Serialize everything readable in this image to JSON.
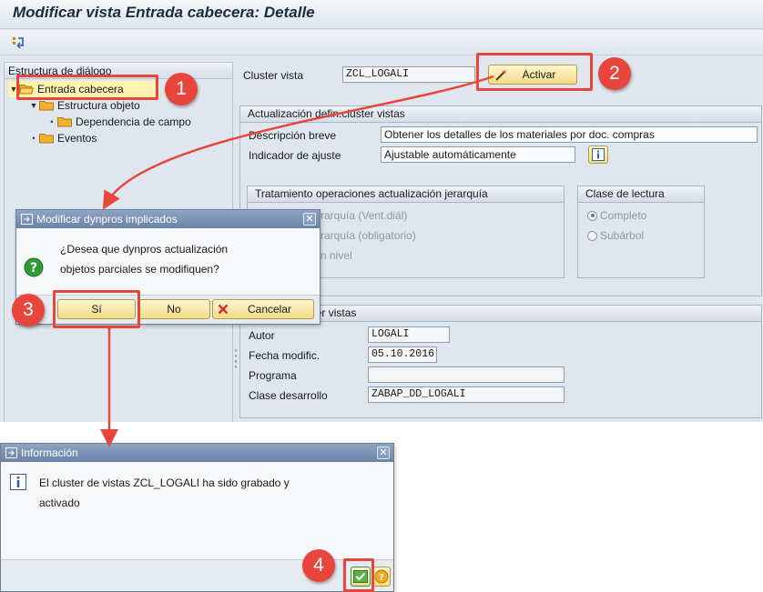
{
  "window": {
    "title": "Modificar vista Entrada cabecera: Detalle"
  },
  "tree": {
    "header": "Estructura de diálogo",
    "items": [
      {
        "label": "Entrada cabecera",
        "selected": true
      },
      {
        "label": "Estructura objeto",
        "selected": false
      },
      {
        "label": "Dependencia de campo",
        "selected": false
      },
      {
        "label": "Eventos",
        "selected": false
      }
    ]
  },
  "cluster": {
    "label": "Cluster vista",
    "value": "ZCL_LOGALI",
    "activate_label": "Activar"
  },
  "group_update": {
    "title": "Actualización defin.cluster vistas",
    "desc_label": "Descripción breve",
    "desc_value": "Obtener los detalles de los materiales por doc. compras",
    "adjust_label": "Indicador de ajuste",
    "adjust_value": "Ajustable automáticamente"
  },
  "group_hierarchy": {
    "title": "Tratamiento operaciones actualización jerarquía",
    "option1": "rarquía (Vent.diál)",
    "option2": "rarquía (obligatorio)",
    "option3": "n nivel"
  },
  "group_read": {
    "title": "Clase de lectura",
    "option_complete": "Completo",
    "option_subtree": "Subárbol"
  },
  "group_admin": {
    "title": "ra definir cluster vistas",
    "author_label": "Autor",
    "author_value": "LOGALI",
    "date_label": "Fecha modific.",
    "date_value": "05.10.2016",
    "program_label": "Programa",
    "program_value": "",
    "devclass_label": "Clase desarrollo",
    "devclass_value": "ZABAP_DD_LOGALI"
  },
  "dialog_confirm": {
    "title": "Modificar dynpros implicados",
    "line1": "¿Desea que dynpros actualización",
    "line2": "objetos parciales se modifiquen?",
    "yes_label": "Sí",
    "no_label": "No",
    "cancel_label": "Cancelar"
  },
  "dialog_info": {
    "title": "Información",
    "line1": "El cluster de vistas ZCL_LOGALI ha sido grabado y",
    "line2": "activado"
  },
  "steps": [
    "1",
    "2",
    "3",
    "4"
  ],
  "colors": {
    "highlight": "#e8453c",
    "button_yellow": "#f3dc86",
    "dialog_title": "#6a82a8",
    "tree_selected": "#fff3b0"
  }
}
